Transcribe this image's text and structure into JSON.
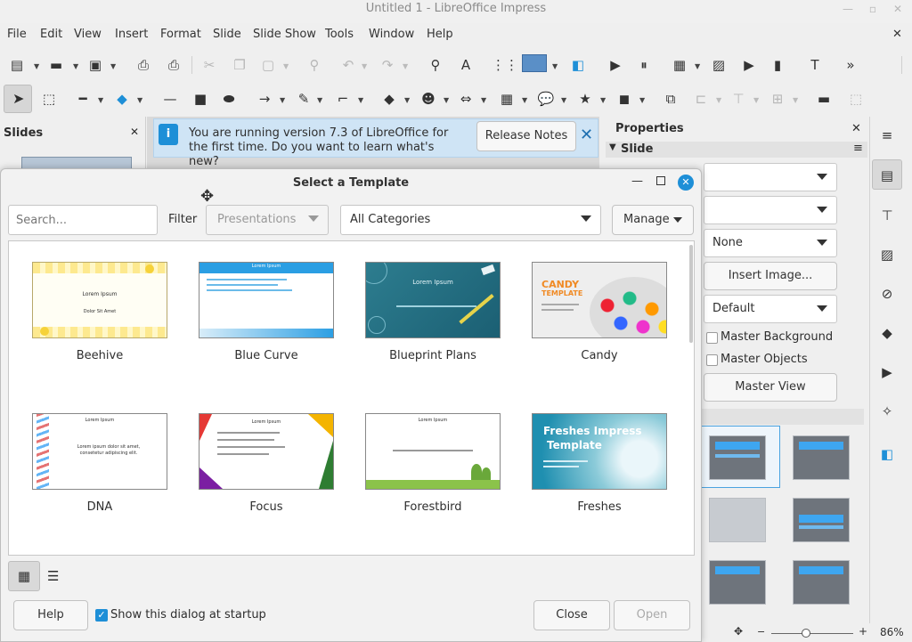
{
  "window": {
    "title": "Untitled 1 - LibreOffice Impress"
  },
  "menu": [
    "File",
    "Edit",
    "View",
    "Insert",
    "Format",
    "Slide",
    "Slide Show",
    "Tools",
    "Window",
    "Help"
  ],
  "slides_panel": {
    "title": "Slides"
  },
  "infobar": {
    "message": "You are running version 7.3 of LibreOffice for the first time. Do you want to learn what's new?",
    "button": "Release Notes"
  },
  "properties": {
    "title": "Properties",
    "section": "Slide",
    "fields": [
      "",
      "",
      "None",
      "Insert Image...",
      "Default"
    ],
    "checkboxes": [
      "Master Background",
      "Master Objects"
    ],
    "master_view": "Master View"
  },
  "dialog": {
    "title": "Select a Template",
    "search_placeholder": "Search...",
    "filter_label": "Filter",
    "filter_value": "Presentations",
    "category_value": "All Categories",
    "manage": "Manage",
    "templates": [
      "Beehive",
      "Blue Curve",
      "Blueprint Plans",
      "Candy",
      "DNA",
      "Focus",
      "Forestbird",
      "Freshes"
    ],
    "thumb_text": {
      "lorem": "Lorem Ipsum",
      "dolor": "Dolor Sit Amet",
      "candy": "CANDY",
      "template": "TEMPLATE",
      "freshes1": "Freshes Impress",
      "freshes2": "Template",
      "dna_body": "Lorem ipsum dolor sit amet, consetetur adipiscing elit."
    },
    "help": "Help",
    "show_startup": "Show this dialog at startup",
    "close": "Close",
    "open": "Open"
  },
  "statusbar": {
    "zoom": "86%"
  },
  "colors": {
    "accent": "#1e8fd7",
    "infobar": "#cfe4f5",
    "candy_orange": "#f08a24"
  }
}
